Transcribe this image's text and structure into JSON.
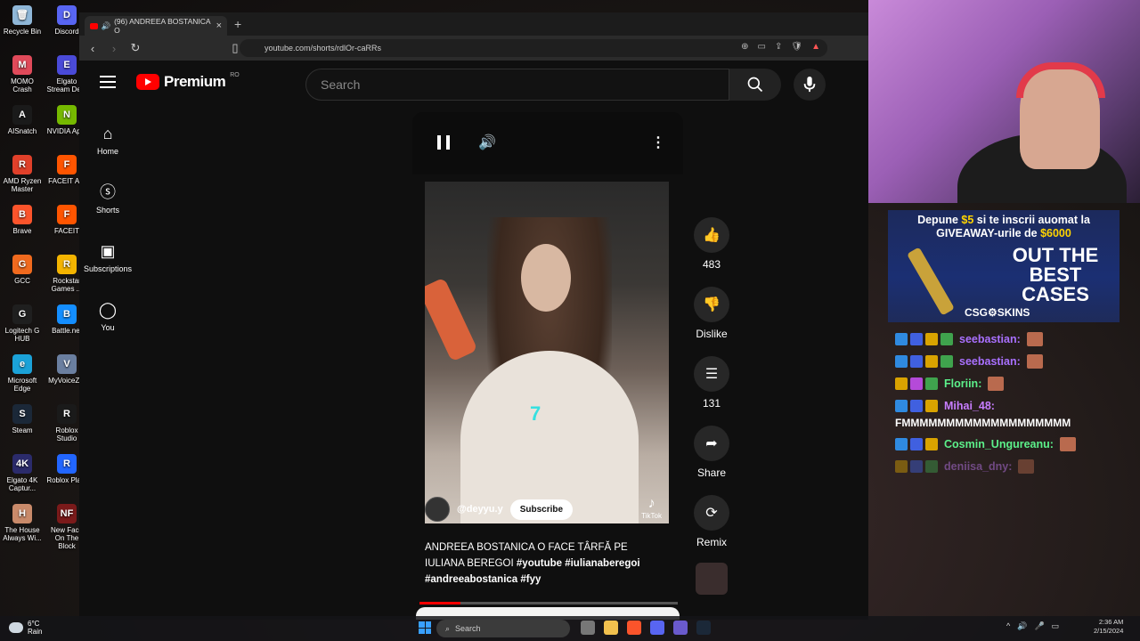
{
  "desktop_icons": [
    {
      "label": "Recycle Bin",
      "color": "#8fb7d8",
      "glyph": "🗑"
    },
    {
      "label": "Discord",
      "color": "#5865f2",
      "glyph": "D"
    },
    {
      "label": "MOMO Crash",
      "color": "#e04a5a",
      "glyph": "M"
    },
    {
      "label": "Elgato Stream De...",
      "color": "#4a4ad8",
      "glyph": "E"
    },
    {
      "label": "AISnatch",
      "color": "#1a1a1a",
      "glyph": "A"
    },
    {
      "label": "NVIDIA Ap...",
      "color": "#76b900",
      "glyph": "N"
    },
    {
      "label": "AMD Ryzen Master",
      "color": "#e0402a",
      "glyph": "R"
    },
    {
      "label": "FACEIT A...",
      "color": "#ff5500",
      "glyph": "F"
    },
    {
      "label": "Brave",
      "color": "#fb542b",
      "glyph": "B"
    },
    {
      "label": "FACEIT",
      "color": "#ff5500",
      "glyph": "F"
    },
    {
      "label": "GCC",
      "color": "#f06a1e",
      "glyph": "G"
    },
    {
      "label": "Rockstar Games ...",
      "color": "#f4b400",
      "glyph": "R"
    },
    {
      "label": "Logitech G HUB",
      "color": "#1f1f1f",
      "glyph": "G"
    },
    {
      "label": "Battle.net",
      "color": "#148eff",
      "glyph": "B"
    },
    {
      "label": "Microsoft Edge",
      "color": "#1ba2d8",
      "glyph": "e"
    },
    {
      "label": "MyVoiceZ...",
      "color": "#6b7fa0",
      "glyph": "V"
    },
    {
      "label": "Steam",
      "color": "#1b2838",
      "glyph": "S"
    },
    {
      "label": "Roblox Studio",
      "color": "#1a1a1a",
      "glyph": "R"
    },
    {
      "label": "Elgato 4K Captur...",
      "color": "#2b2b6b",
      "glyph": "4K"
    },
    {
      "label": "Roblox Pla...",
      "color": "#2266ff",
      "glyph": "R"
    },
    {
      "label": "The House Always Wi...",
      "color": "#c98a6a",
      "glyph": "H"
    },
    {
      "label": "New Face On The Block",
      "color": "#7a1a1a",
      "glyph": "NF"
    }
  ],
  "browser": {
    "tab_title": "(96) ANDREEA BOSTANICA O",
    "url": "youtube.com/shorts/rdlOr-caRRs"
  },
  "youtube": {
    "logo_text": "Premium",
    "region": "RO",
    "search_placeholder": "Search",
    "nav": [
      {
        "label": "Home",
        "icon": "home-icon"
      },
      {
        "label": "Shorts",
        "icon": "shorts-icon"
      },
      {
        "label": "Subscriptions",
        "icon": "subscriptions-icon"
      },
      {
        "label": "You",
        "icon": "you-icon"
      }
    ]
  },
  "short": {
    "channel": "@deyyu.y",
    "subscribe_label": "Subscribe",
    "overlay_number": "7",
    "watermark": "TikTok",
    "title_text": "ANDREEA BOSTANICA O FACE TÂRFĂ PE IULIANA BEREGOI",
    "hashtags": "#youtube  #iulianaberegoi #andreeabostanica #fyy",
    "progress": 0.16
  },
  "actions": {
    "like_count": "483",
    "dislike_label": "Dislike",
    "comment_count": "131",
    "share_label": "Share",
    "remix_label": "Remix"
  },
  "stream_ad": {
    "line1_a": "Depune ",
    "line1_amount": "$5",
    "line1_b": " si te inscrii auomat la",
    "line2_a": "GIVEAWAY-urile de ",
    "line2_amount": "$6000",
    "big_text": "OUT THE BEST CASES",
    "brand": "CSG⚙SKINS"
  },
  "chat": [
    {
      "user": "seebastian:",
      "color": "c-purple",
      "message": ""
    },
    {
      "user": "seebastian:",
      "color": "c-purple",
      "message": ""
    },
    {
      "user": "Floriin:",
      "color": "c-green",
      "message": ""
    },
    {
      "user": "Mihai_48:",
      "color": "c-pink",
      "message": "FMMMMMMMMMMMMMMMMMMM"
    },
    {
      "user": "Cosmin_Ungureanu:",
      "color": "c-green",
      "message": ""
    },
    {
      "user": "deniisa_dny:",
      "color": "c-pink",
      "message": ""
    }
  ],
  "taskbar": {
    "temp": "6°C",
    "weather": "Rain",
    "search_label": "Search",
    "time": "2:36 AM",
    "date": "2/15/2024"
  }
}
